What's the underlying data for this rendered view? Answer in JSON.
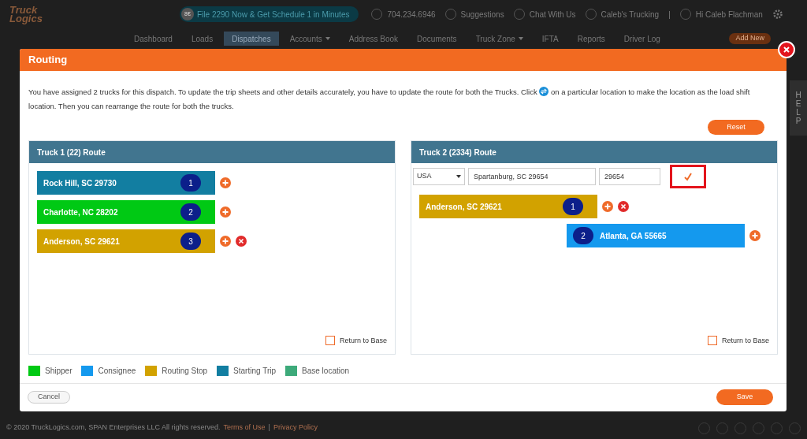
{
  "header": {
    "logo": [
      "Truck",
      "Logics"
    ],
    "promo": "File 2290 Now & Get Schedule 1 in Minutes",
    "promo_badge": "8€",
    "phone": "704.234.6946",
    "links": [
      "Suggestions",
      "Chat With Us",
      "Caleb's Trucking"
    ],
    "separator": "|",
    "user": "Hi Caleb Flachman"
  },
  "nav": {
    "items": [
      {
        "label": "Dashboard",
        "selected": false,
        "dropdown": false
      },
      {
        "label": "Loads",
        "selected": false,
        "dropdown": false
      },
      {
        "label": "Dispatches",
        "selected": true,
        "dropdown": false
      },
      {
        "label": "Accounts",
        "selected": false,
        "dropdown": true
      },
      {
        "label": "Address Book",
        "selected": false,
        "dropdown": false
      },
      {
        "label": "Documents",
        "selected": false,
        "dropdown": false
      },
      {
        "label": "Truck Zone",
        "selected": false,
        "dropdown": true
      },
      {
        "label": "IFTA",
        "selected": false,
        "dropdown": false
      },
      {
        "label": "Reports",
        "selected": false,
        "dropdown": false
      },
      {
        "label": "Driver Log",
        "selected": false,
        "dropdown": false
      }
    ],
    "add_button": "Add New"
  },
  "help_tab": "HELP",
  "footer": {
    "copyright": "© 2020 TruckLogics.com, SPAN Enterprises LLC All rights reserved.",
    "links": [
      "Terms of Use",
      "Privacy Policy"
    ],
    "separator": "|"
  },
  "dialog": {
    "title": "Routing",
    "instructions_before": "You have assigned 2 trucks for this dispatch. To update the trip sheets and other details accurately, you have to update the route for both the Trucks. Click",
    "instructions_after": "on a particular location to make the location as the load shift location. Then you can rearrange the route for both the trucks.",
    "reset": "Reset",
    "trucks": [
      {
        "title": "Truck 1 (22) Route",
        "stops": [
          {
            "label": "Rock Hill, SC 29730",
            "number": "1",
            "color": "#127ea1",
            "kind": "stop",
            "removable": false
          },
          {
            "label": "Charlotte, NC 28202",
            "number": "2",
            "color": "#00c914",
            "kind": "stop",
            "removable": false
          },
          {
            "label": "Anderson, SC 29621",
            "number": "3",
            "color": "#d2a200",
            "kind": "stop",
            "removable": true
          }
        ],
        "return_to_base": {
          "label": "Return to Base",
          "checked": false
        }
      },
      {
        "title": "Truck 2 (2334) Route",
        "form": {
          "country": "USA",
          "city": "Spartanburg, SC 29654",
          "zip": "29654"
        },
        "stops": [
          {
            "label": "Anderson, SC 29621",
            "number": "1",
            "color": "#d2a200",
            "kind": "stop",
            "removable": true
          },
          {
            "label": "Atlanta, GA 55665",
            "number": "2",
            "color": "#1499ee",
            "kind": "shift",
            "removable": false
          }
        ],
        "return_to_base": {
          "label": "Return to Base",
          "checked": false
        }
      }
    ],
    "legend": [
      {
        "label": "Shipper",
        "color": "#00c914"
      },
      {
        "label": "Consignee",
        "color": "#1499ee"
      },
      {
        "label": "Routing Stop",
        "color": "#d2a200"
      },
      {
        "label": "Starting Trip",
        "color": "#127ea1"
      },
      {
        "label": "Base location",
        "color": "#3daa7a"
      }
    ],
    "cancel": "Cancel",
    "save": "Save"
  }
}
